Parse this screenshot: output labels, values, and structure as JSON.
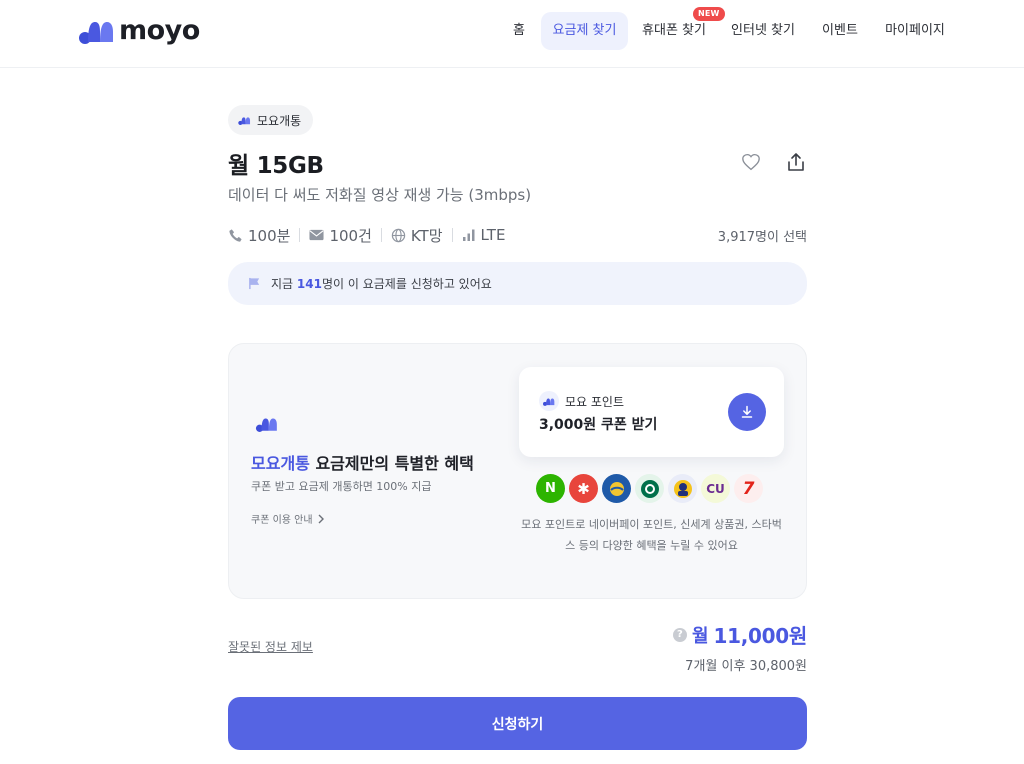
{
  "header": {
    "logo_text": "moyo",
    "nav": [
      {
        "label": "홈",
        "active": false
      },
      {
        "label": "요금제 찾기",
        "active": true
      },
      {
        "label": "휴대폰 찾기",
        "badge": "NEW",
        "active": false
      },
      {
        "label": "인터넷 찾기",
        "active": false
      },
      {
        "label": "이벤트",
        "active": false
      },
      {
        "label": "마이페이지",
        "active": false
      }
    ]
  },
  "plan": {
    "carrier_chip": "모요개통",
    "title": "월 15GB",
    "subtitle": "데이터 다 써도 저화질 영상 재생 가능 (3mbps)",
    "specs": {
      "voice": "100분",
      "sms": "100건",
      "network": "KT망",
      "type": "LTE"
    },
    "selected_count": "3,917명이 선택",
    "live_banner": {
      "prefix": "지금 ",
      "count": "141",
      "suffix": "명이 이 요금제를 신청하고 있어요"
    }
  },
  "benefit": {
    "title_accent": "모요개통",
    "title_rest": " 요금제만의 특별한 혜택",
    "description": "쿠폰 받고 요금제 개통하면 100% 지급",
    "link": "쿠폰 이용 안내",
    "point_card": {
      "label": "모요 포인트",
      "amount": "3,000원 쿠폰 받기"
    },
    "brands": [
      {
        "name": "naver-pay",
        "text": "N",
        "bg": "#2db400",
        "fg": "#ffffff"
      },
      {
        "name": "shinsegae",
        "text": "✱",
        "bg": "#e8453c",
        "fg": "#ffffff"
      },
      {
        "name": "brand-3",
        "text": "",
        "bg": "#1f5aa8",
        "fg": "#f2c530"
      },
      {
        "name": "starbucks",
        "text": "",
        "bg": "#e4f4ea",
        "fg": "#00704a"
      },
      {
        "name": "brand-5",
        "text": "",
        "bg": "#e9ecf8",
        "fg": "#20307a"
      },
      {
        "name": "cu",
        "text": "CU",
        "bg": "#f4f9d8",
        "fg": "#6b2c91"
      },
      {
        "name": "seven-eleven",
        "text": "7",
        "bg": "#fdeeee",
        "fg": "#e2231a"
      }
    ],
    "brand_note": "모요 포인트로 네이버페이 포인트, 신세계 상품권, 스타벅스 등의 다양한 혜택을 누릴 수 있어요"
  },
  "pricing": {
    "report_link": "잘못된 정보 제보",
    "help_icon": "?",
    "price_prefix": "월",
    "price": "11,000원",
    "after": "7개월 이후 30,800원"
  },
  "cta": {
    "label": "신청하기"
  },
  "colors": {
    "accent": "#4a58e0",
    "button": "#5564e3"
  }
}
